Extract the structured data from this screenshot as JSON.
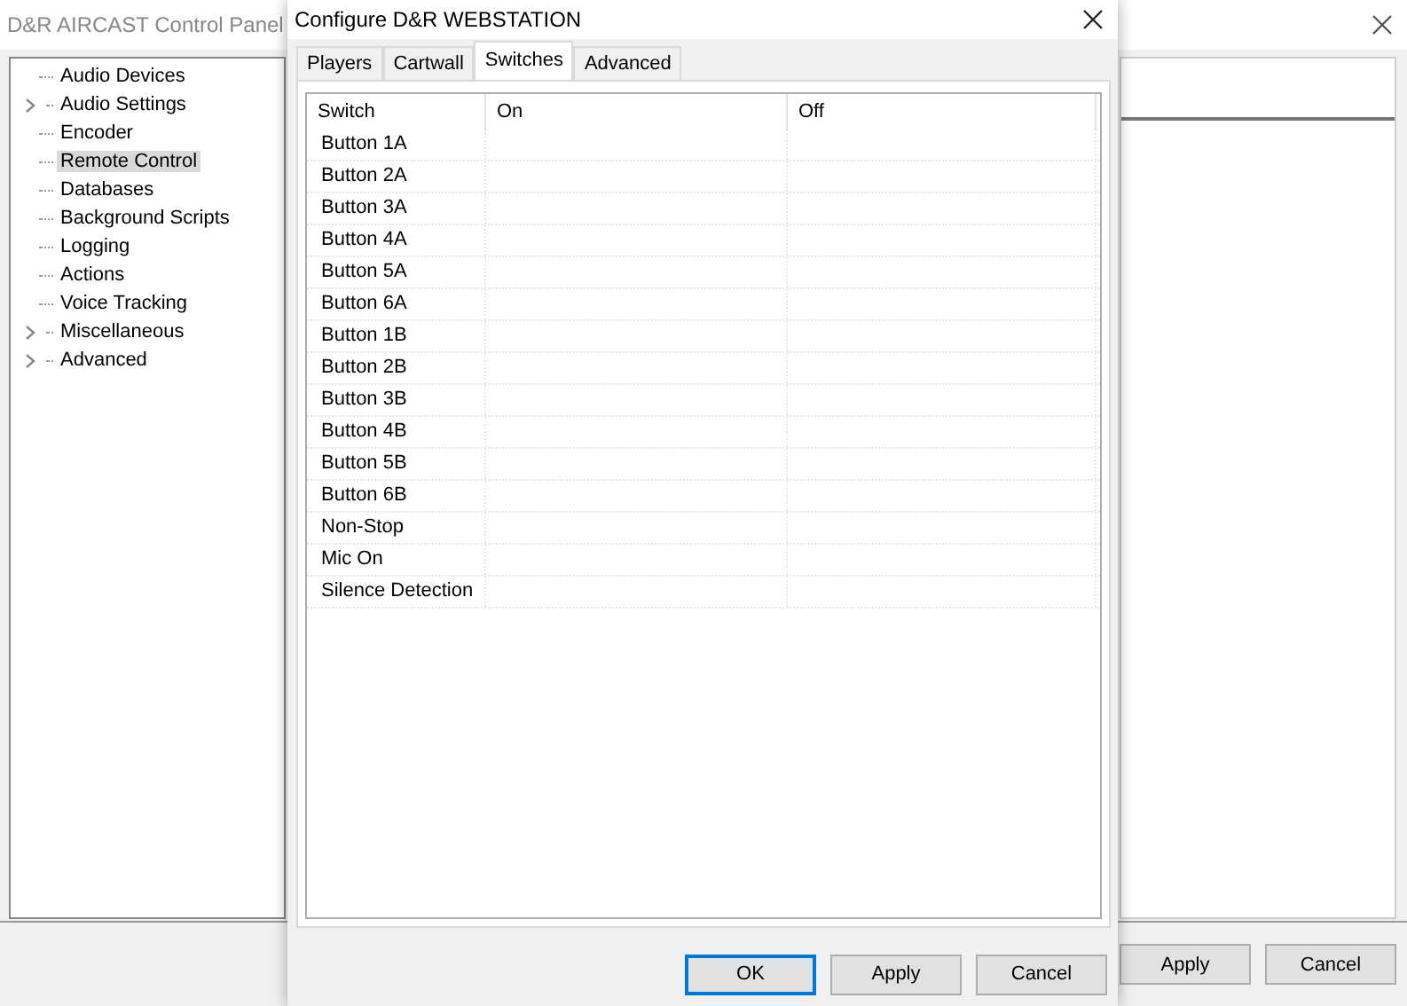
{
  "main_window": {
    "title": "D&R AIRCAST Control Panel",
    "tree": [
      {
        "label": "Audio Devices",
        "expandable": false,
        "selected": false
      },
      {
        "label": "Audio Settings",
        "expandable": true,
        "selected": false
      },
      {
        "label": "Encoder",
        "expandable": false,
        "selected": false
      },
      {
        "label": "Remote Control",
        "expandable": false,
        "selected": true
      },
      {
        "label": "Databases",
        "expandable": false,
        "selected": false
      },
      {
        "label": "Background Scripts",
        "expandable": false,
        "selected": false
      },
      {
        "label": "Logging",
        "expandable": false,
        "selected": false
      },
      {
        "label": "Actions",
        "expandable": false,
        "selected": false
      },
      {
        "label": "Voice Tracking",
        "expandable": false,
        "selected": false
      },
      {
        "label": "Miscellaneous",
        "expandable": true,
        "selected": false
      },
      {
        "label": "Advanced",
        "expandable": true,
        "selected": false
      }
    ],
    "buttons": [
      "Apply",
      "Cancel"
    ]
  },
  "dialog": {
    "title": "Configure D&R WEBSTATION",
    "tabs": [
      {
        "label": "Players",
        "selected": false
      },
      {
        "label": "Cartwall",
        "selected": false
      },
      {
        "label": "Switches",
        "selected": true
      },
      {
        "label": "Advanced",
        "selected": false
      }
    ],
    "table": {
      "columns": [
        "Switch",
        "On",
        "Off"
      ],
      "rows": [
        "Button 1A",
        "Button 2A",
        "Button 3A",
        "Button 4A",
        "Button 5A",
        "Button 6A",
        "Button 1B",
        "Button 2B",
        "Button 3B",
        "Button 4B",
        "Button 5B",
        "Button 6B",
        "Non-Stop",
        "Mic On",
        "Silence Detection"
      ]
    },
    "buttons": [
      {
        "label": "OK",
        "default": true
      },
      {
        "label": "Apply",
        "default": false
      },
      {
        "label": "Cancel",
        "default": false
      }
    ]
  }
}
